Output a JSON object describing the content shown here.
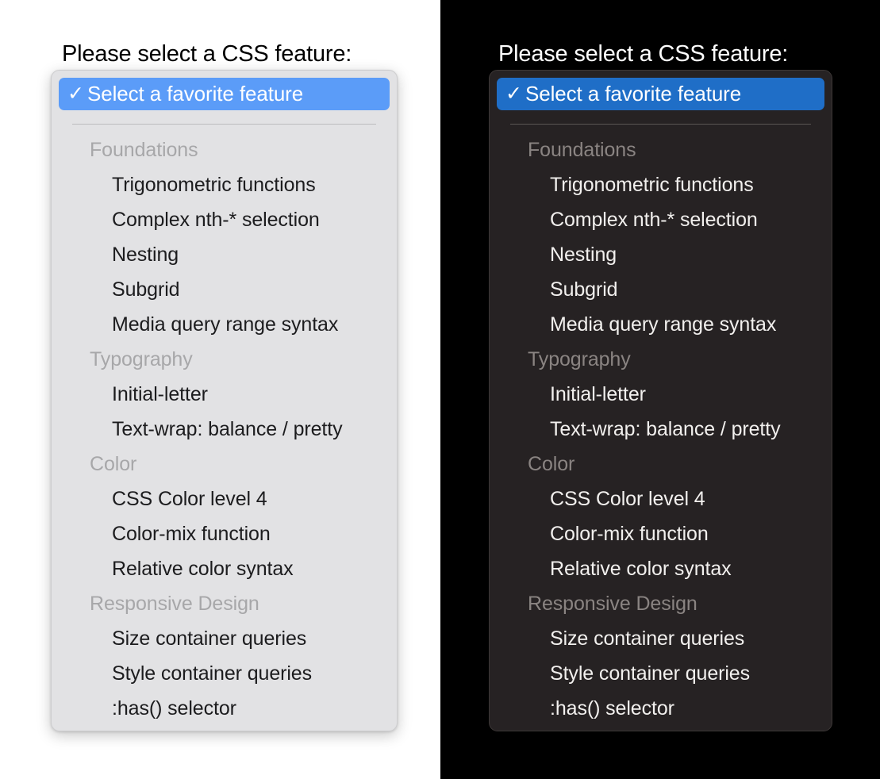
{
  "prompt": "Please select a CSS feature:",
  "selected_option": {
    "label": "Select a favorite feature",
    "check_icon": "✓"
  },
  "colors": {
    "light_panel_bg": "#e2e2e4",
    "light_highlight": "#5b9cf8",
    "light_group_label": "#a7a7a9",
    "light_item_text": "#1c1c1e",
    "light_separator": "#bcbcbe",
    "dark_pane_bg": "#000000",
    "dark_panel_bg": "#262223",
    "dark_highlight": "#1f6ec7",
    "dark_group_label": "#8a8482",
    "dark_item_text": "#f2f0ee",
    "dark_separator": "#5a5553"
  },
  "groups": [
    {
      "label": "Foundations",
      "options": [
        "Trigonometric functions",
        "Complex nth-* selection",
        "Nesting",
        "Subgrid",
        "Media query range syntax"
      ]
    },
    {
      "label": "Typography",
      "options": [
        "Initial-letter",
        "Text-wrap: balance / pretty"
      ]
    },
    {
      "label": "Color",
      "options": [
        "CSS Color level 4",
        "Color-mix function",
        "Relative color syntax"
      ]
    },
    {
      "label": "Responsive Design",
      "options": [
        "Size container queries",
        "Style container queries",
        ":has() selector"
      ]
    }
  ]
}
